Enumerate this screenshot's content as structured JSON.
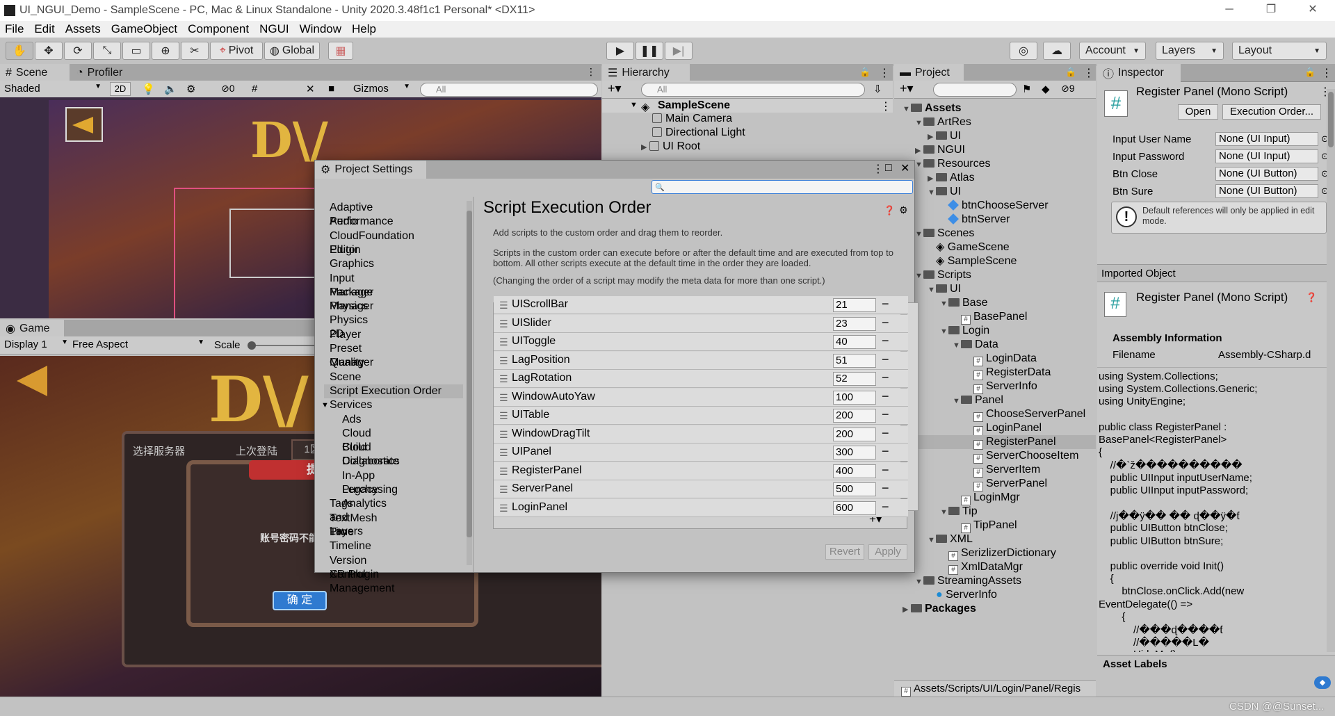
{
  "window": {
    "title": "UI_NGUI_Demo - SampleScene - PC, Mac & Linux Standalone - Unity 2020.3.48f1c1 Personal* <DX11>",
    "minimize": "─",
    "restore": "❐",
    "close": "✕"
  },
  "menu": [
    "File",
    "Edit",
    "Assets",
    "GameObject",
    "Component",
    "NGUI",
    "Window",
    "Help"
  ],
  "toolbar": {
    "pivot": "Pivot",
    "global": "Global",
    "account": "Account",
    "layers": "Layers",
    "layout": "Layout"
  },
  "scene": {
    "tab": "Scene",
    "tab2": "Profiler",
    "shading": "Shaded",
    "mode2d": "2D",
    "gizmos": "Gizmos",
    "search": "All",
    "hidden_count": "0"
  },
  "game": {
    "tab": "Game",
    "display": "Display 1",
    "aspect": "Free Aspect",
    "scale": "Scale",
    "server_tab1": "选择服务器",
    "server_tab2": "上次登陆",
    "server_tab3": "1区",
    "prompt": "提示",
    "message": "账号密码不能",
    "confirm": "确 定"
  },
  "hierarchy": {
    "tab": "Hierarchy",
    "search": "All",
    "scene": "SampleScene",
    "items": [
      "Main Camera",
      "Directional Light",
      "UI Root"
    ]
  },
  "project": {
    "tab": "Project",
    "hidden_count": "9",
    "path": "Assets/Scripts/UI/Login/Panel/Regis",
    "tree": [
      {
        "t": "Assets",
        "lvl": 0,
        "type": "folder",
        "open": true,
        "bold": true
      },
      {
        "t": "ArtRes",
        "lvl": 1,
        "type": "folder",
        "open": true
      },
      {
        "t": "UI",
        "lvl": 2,
        "type": "folder",
        "open": false
      },
      {
        "t": "NGUI",
        "lvl": 1,
        "type": "folder",
        "open": false
      },
      {
        "t": "Resources",
        "lvl": 1,
        "type": "folder",
        "open": true
      },
      {
        "t": "Atlas",
        "lvl": 2,
        "type": "folder",
        "open": false
      },
      {
        "t": "UI",
        "lvl": 2,
        "type": "folder",
        "open": true
      },
      {
        "t": "btnChooseServer",
        "lvl": 3,
        "type": "prefab"
      },
      {
        "t": "btnServer",
        "lvl": 3,
        "type": "prefab"
      },
      {
        "t": "Scenes",
        "lvl": 1,
        "type": "folder",
        "open": true
      },
      {
        "t": "GameScene",
        "lvl": 2,
        "type": "scene"
      },
      {
        "t": "SampleScene",
        "lvl": 2,
        "type": "scene"
      },
      {
        "t": "Scripts",
        "lvl": 1,
        "type": "folder",
        "open": true
      },
      {
        "t": "UI",
        "lvl": 2,
        "type": "folder",
        "open": true
      },
      {
        "t": "Base",
        "lvl": 3,
        "type": "folder",
        "open": true
      },
      {
        "t": "BasePanel",
        "lvl": 4,
        "type": "cs"
      },
      {
        "t": "Login",
        "lvl": 3,
        "type": "folder",
        "open": true
      },
      {
        "t": "Data",
        "lvl": 4,
        "type": "folder",
        "open": true
      },
      {
        "t": "LoginData",
        "lvl": 5,
        "type": "cs"
      },
      {
        "t": "RegisterData",
        "lvl": 5,
        "type": "cs"
      },
      {
        "t": "ServerInfo",
        "lvl": 5,
        "type": "cs"
      },
      {
        "t": "Panel",
        "lvl": 4,
        "type": "folder",
        "open": true
      },
      {
        "t": "ChooseServerPanel",
        "lvl": 5,
        "type": "cs"
      },
      {
        "t": "LoginPanel",
        "lvl": 5,
        "type": "cs"
      },
      {
        "t": "RegisterPanel",
        "lvl": 5,
        "type": "cs",
        "selected": true
      },
      {
        "t": "ServerChooseItem",
        "lvl": 5,
        "type": "cs"
      },
      {
        "t": "ServerItem",
        "lvl": 5,
        "type": "cs"
      },
      {
        "t": "ServerPanel",
        "lvl": 5,
        "type": "cs"
      },
      {
        "t": "LoginMgr",
        "lvl": 4,
        "type": "cs"
      },
      {
        "t": "Tip",
        "lvl": 3,
        "type": "folder",
        "open": true
      },
      {
        "t": "TipPanel",
        "lvl": 4,
        "type": "cs"
      },
      {
        "t": "XML",
        "lvl": 2,
        "type": "folder",
        "open": true
      },
      {
        "t": "SerizlizerDictionary",
        "lvl": 3,
        "type": "cs"
      },
      {
        "t": "XmlDataMgr",
        "lvl": 3,
        "type": "cs"
      },
      {
        "t": "StreamingAssets",
        "lvl": 1,
        "type": "folder",
        "open": true
      },
      {
        "t": "ServerInfo",
        "lvl": 2,
        "type": "asset"
      },
      {
        "t": "Packages",
        "lvl": 0,
        "type": "folder",
        "open": false,
        "bold": true
      }
    ]
  },
  "inspector": {
    "tab": "Inspector",
    "title": "Register Panel (Mono Script)",
    "open": "Open",
    "exec_order": "Execution Order...",
    "fields": [
      {
        "label": "Input User Name",
        "value": "None (UI Input)"
      },
      {
        "label": "Input Password",
        "value": "None (UI Input)"
      },
      {
        "label": "Btn Close",
        "value": "None (UI Button)"
      },
      {
        "label": "Btn Sure",
        "value": "None (UI Button)"
      }
    ],
    "note": "Default references will only be applied in edit mode.",
    "imported": "Imported Object",
    "imported_title": "Register Panel (Mono Script)",
    "assembly_info": "Assembly Information",
    "filename_label": "Filename",
    "filename_value": "Assembly-CSharp.d",
    "code": [
      "using System.Collections;",
      "using System.Collections.Generic;",
      "using UnityEngine;",
      "",
      "public class RegisterPanel :",
      "BasePanel<RegisterPanel>",
      "{",
      "    //�`ž����������",
      "    public UIInput inputUserName;",
      "    public UIInput inputPassword;",
      "",
      "    //j��ӱ�� �� ɖ��ӱ�ƭ",
      "    public UIButton btnClose;",
      "    public UIButton btnSure;",
      "",
      "    public override void Init()",
      "    {",
      "        btnClose.onClick.Add(new",
      "EventDelegate(() =>",
      "        {",
      "            //���ɖ����ƭ",
      "            //�����L�",
      "            HideMe();"
    ],
    "asset_labels": "Asset Labels"
  },
  "settings": {
    "tab": "Project Settings",
    "title": "Script Execution Order",
    "items": [
      "Adaptive Performance",
      "Audio",
      "CloudFoundation Plugin",
      "Editor",
      "Graphics",
      "Input Manager",
      "Package Manager",
      "Physics",
      "Physics 2D",
      "Player",
      "Preset Manager",
      "Quality",
      "Scene Template",
      "Script Execution Order",
      "Services",
      "Ads",
      "Cloud Build",
      "Cloud Diagnostics",
      "Collaborate",
      "In-App Purchasing",
      "Legacy Analytics",
      "Tags and Layers",
      "TextMesh Pro",
      "Time",
      "Timeline",
      "Version Control",
      "XR Plugin Management"
    ],
    "desc1": "Add scripts to the custom order and drag them to reorder.",
    "desc2": "Scripts in the custom order can execute before or after the default time and are executed from top to bottom. All other scripts execute at the default time in the order they are loaded.",
    "desc3": "(Changing the order of a script may modify the meta data for more than one script.)",
    "rows": [
      {
        "name": "UIScrollBar",
        "value": "21"
      },
      {
        "name": "UISlider",
        "value": "23"
      },
      {
        "name": "UIToggle",
        "value": "40"
      },
      {
        "name": "LagPosition",
        "value": "51"
      },
      {
        "name": "LagRotation",
        "value": "52"
      },
      {
        "name": "WindowAutoYaw",
        "value": "100"
      },
      {
        "name": "UITable",
        "value": "200"
      },
      {
        "name": "WindowDragTilt",
        "value": "200"
      },
      {
        "name": "UIPanel",
        "value": "300"
      },
      {
        "name": "RegisterPanel",
        "value": "400"
      },
      {
        "name": "ServerPanel",
        "value": "500"
      },
      {
        "name": "LoginPanel",
        "value": "600"
      }
    ],
    "revert": "Revert",
    "apply": "Apply"
  },
  "watermark": "CSDN @@Sunset..."
}
